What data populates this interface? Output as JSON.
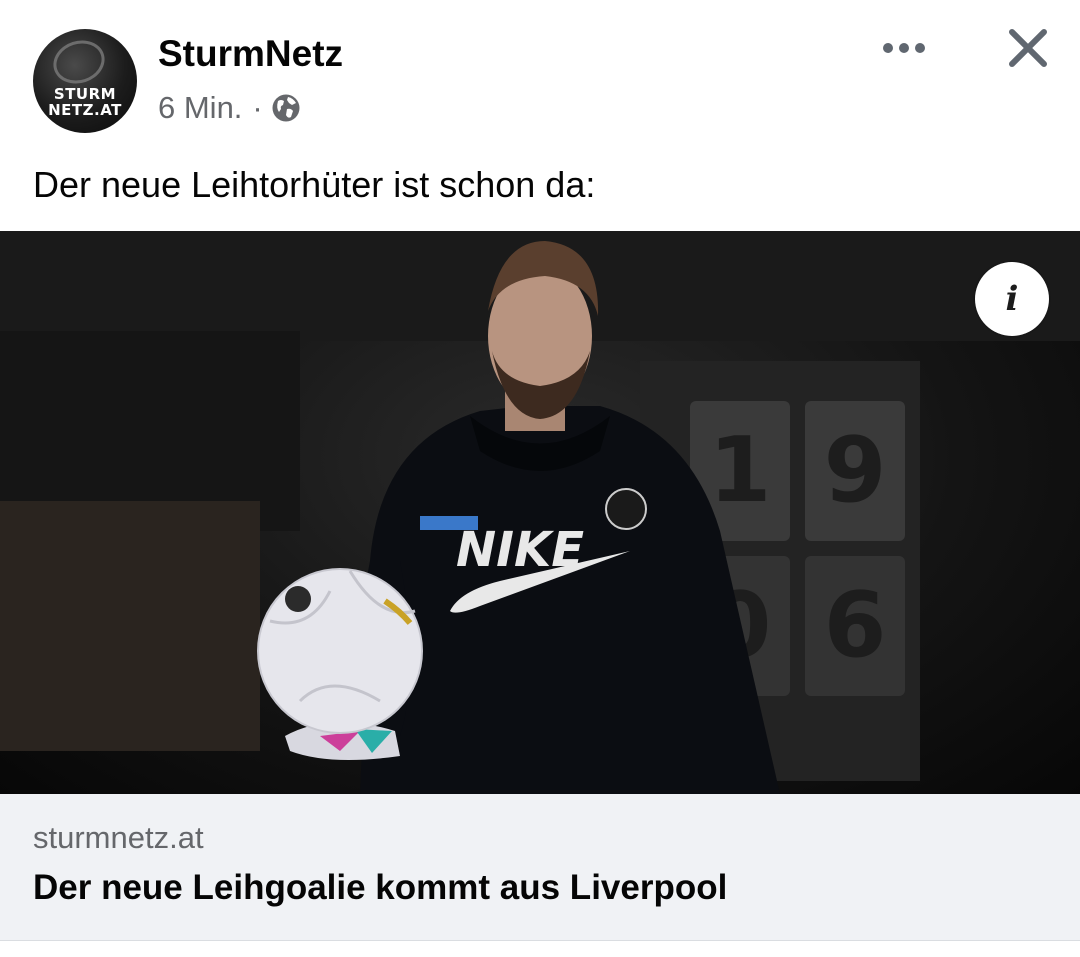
{
  "post": {
    "author": "SturmNetz",
    "timestamp": "6 Min.",
    "separator": "·",
    "audience_icon": "globe-icon",
    "caption": "Der neue Leihtorhüter ist schon da:",
    "avatar_text_line1": "STURM",
    "avatar_text_line2": "NETZ.AT"
  },
  "actions": {
    "more_icon": "more-options-icon",
    "close_icon": "close-icon",
    "info_icon": "info-icon",
    "info_glyph": "i"
  },
  "link_preview": {
    "domain": "sturmnetz.at",
    "title": "Der neue Leihgoalie kommt aus Liverpool"
  },
  "photo": {
    "jersey_text": "NIKE",
    "wall_numbers": [
      "19",
      "06"
    ]
  },
  "colors": {
    "text_primary": "#050505",
    "text_secondary": "#65676b",
    "link_bg": "#f0f2f5"
  }
}
